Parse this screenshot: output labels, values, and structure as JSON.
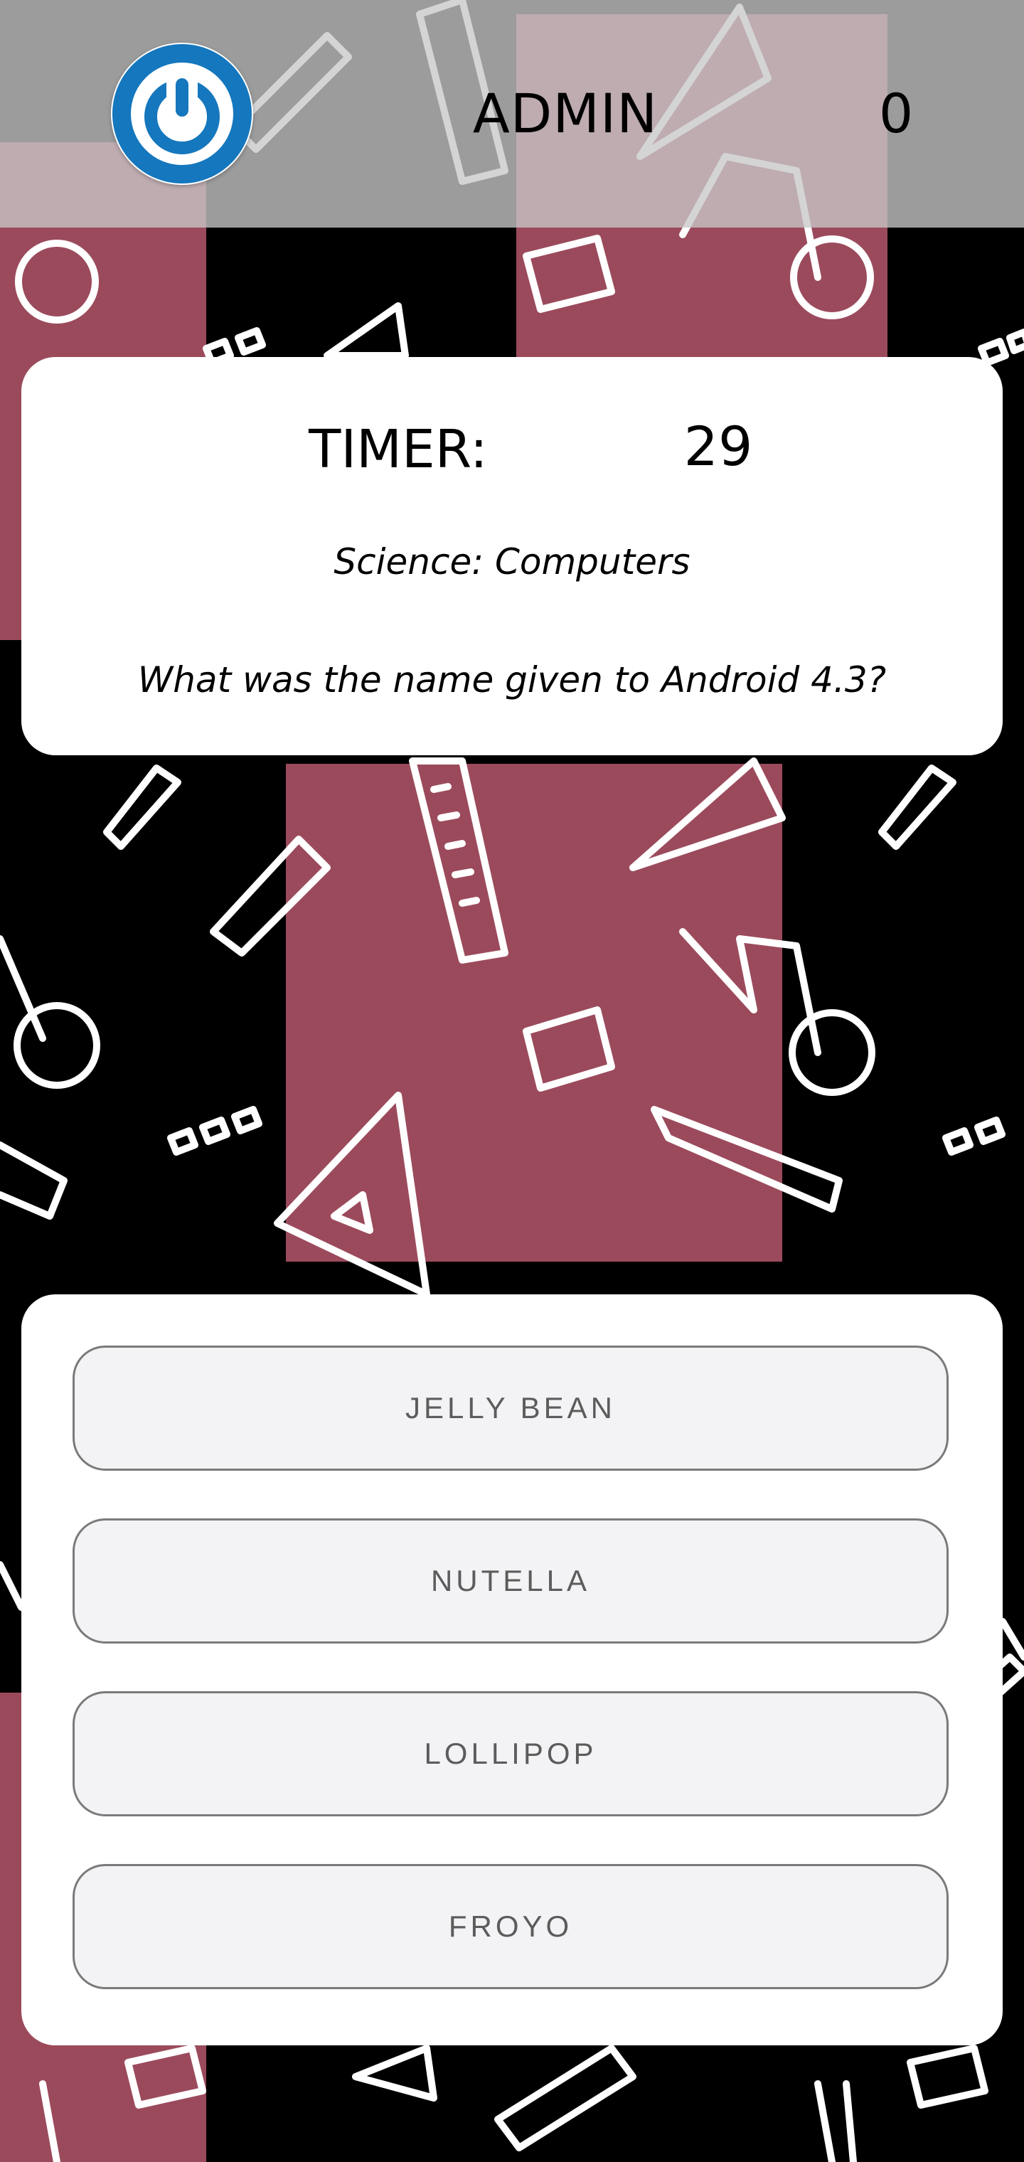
{
  "header": {
    "logo_icon": "power-icon",
    "username": "ADMIN",
    "score": "0"
  },
  "question_card": {
    "timer_label": "TIMER:",
    "timer_value": "29",
    "category": "Science: Computers",
    "question": "What was the name given to Android 4.3?"
  },
  "answers": [
    {
      "label": "JELLY BEAN"
    },
    {
      "label": "NUTELLA"
    },
    {
      "label": "LOLLIPOP"
    },
    {
      "label": "FROYO"
    }
  ],
  "colors": {
    "background": "#000000",
    "pattern_accent": "#9b4a5c",
    "logo_blue": "#1577bd",
    "answer_fill": "#f3f3f5",
    "answer_border": "#7a7a7a"
  }
}
